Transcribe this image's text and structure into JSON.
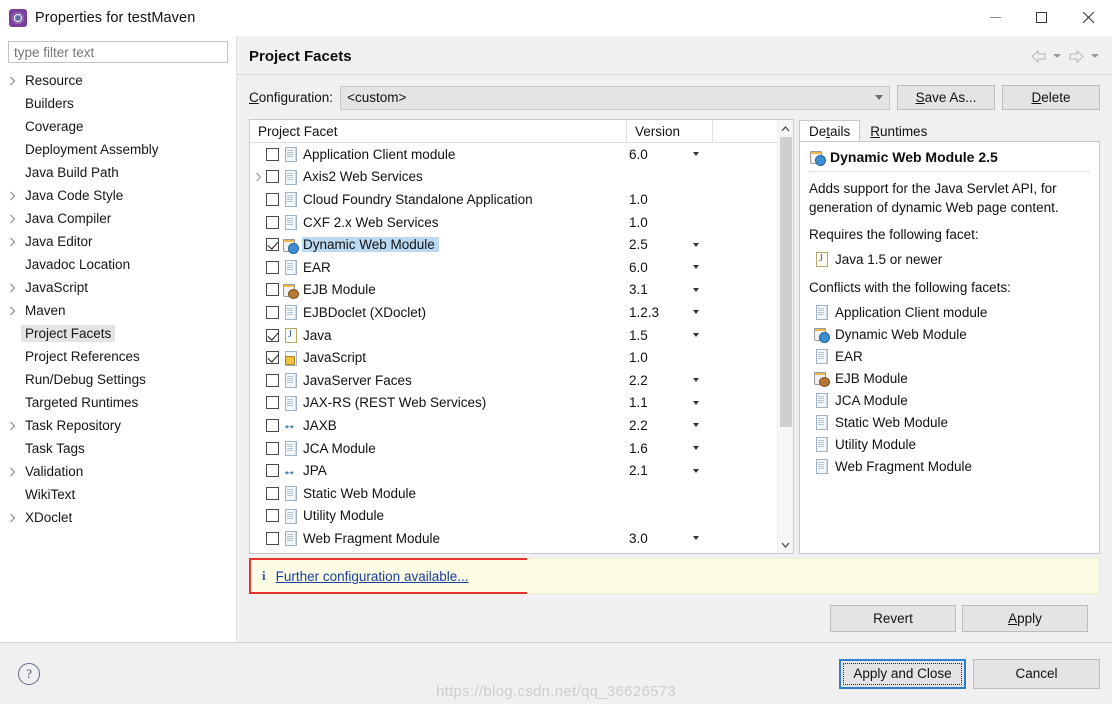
{
  "window": {
    "title": "Properties for testMaven",
    "icon": "eclipse-properties-icon",
    "minimize_label": "—",
    "maximize_label": "□",
    "close_label": "✕"
  },
  "sidebar": {
    "filter_placeholder": "type filter text",
    "filter_value": "",
    "items": [
      {
        "label": "Resource",
        "expandable": true,
        "selected": false
      },
      {
        "label": "Builders",
        "expandable": false,
        "selected": false
      },
      {
        "label": "Coverage",
        "expandable": false,
        "selected": false
      },
      {
        "label": "Deployment Assembly",
        "expandable": false,
        "selected": false
      },
      {
        "label": "Java Build Path",
        "expandable": false,
        "selected": false
      },
      {
        "label": "Java Code Style",
        "expandable": true,
        "selected": false
      },
      {
        "label": "Java Compiler",
        "expandable": true,
        "selected": false
      },
      {
        "label": "Java Editor",
        "expandable": true,
        "selected": false
      },
      {
        "label": "Javadoc Location",
        "expandable": false,
        "selected": false
      },
      {
        "label": "JavaScript",
        "expandable": true,
        "selected": false
      },
      {
        "label": "Maven",
        "expandable": true,
        "selected": false
      },
      {
        "label": "Project Facets",
        "expandable": false,
        "selected": true
      },
      {
        "label": "Project References",
        "expandable": false,
        "selected": false
      },
      {
        "label": "Run/Debug Settings",
        "expandable": false,
        "selected": false
      },
      {
        "label": "Targeted Runtimes",
        "expandable": false,
        "selected": false
      },
      {
        "label": "Task Repository",
        "expandable": true,
        "selected": false
      },
      {
        "label": "Task Tags",
        "expandable": false,
        "selected": false
      },
      {
        "label": "Validation",
        "expandable": true,
        "selected": false
      },
      {
        "label": "WikiText",
        "expandable": false,
        "selected": false
      },
      {
        "label": "XDoclet",
        "expandable": true,
        "selected": false
      }
    ]
  },
  "page": {
    "title": "Project Facets",
    "nav": {
      "back_icon": "back-arrow-icon",
      "back_menu_icon": "chevron-down-icon",
      "forward_icon": "forward-arrow-icon",
      "forward_menu_icon": "chevron-down-icon"
    }
  },
  "configuration": {
    "label": "Configuration:",
    "label_mnemonic": "C",
    "label_rest": "onfiguration:",
    "value": "<custom>",
    "save_as_mnemonic": "S",
    "save_as_rest": "ave As...",
    "delete_mnemonic": "D",
    "delete_rest": "elete"
  },
  "facets_table": {
    "columns": [
      "Project Facet",
      "Version"
    ],
    "rows": [
      {
        "name": "Application Client module",
        "version": "6.0",
        "checked": false,
        "expandable": false,
        "icon": "doc",
        "has_version_menu": true,
        "selected": false
      },
      {
        "name": "Axis2 Web Services",
        "version": "",
        "checked": false,
        "expandable": true,
        "icon": "doc",
        "has_version_menu": false,
        "selected": false
      },
      {
        "name": "Cloud Foundry Standalone Application",
        "version": "1.0",
        "checked": false,
        "expandable": false,
        "icon": "doc",
        "has_version_menu": false,
        "selected": false
      },
      {
        "name": "CXF 2.x Web Services",
        "version": "1.0",
        "checked": false,
        "expandable": false,
        "icon": "doc",
        "has_version_menu": false,
        "selected": false
      },
      {
        "name": "Dynamic Web Module",
        "version": "2.5",
        "checked": true,
        "expandable": false,
        "icon": "web",
        "has_version_menu": true,
        "selected": true
      },
      {
        "name": "EAR",
        "version": "6.0",
        "checked": false,
        "expandable": false,
        "icon": "doc",
        "has_version_menu": true,
        "selected": false
      },
      {
        "name": "EJB Module",
        "version": "3.1",
        "checked": false,
        "expandable": false,
        "icon": "ejb",
        "has_version_menu": true,
        "selected": false
      },
      {
        "name": "EJBDoclet (XDoclet)",
        "version": "1.2.3",
        "checked": false,
        "expandable": false,
        "icon": "doc",
        "has_version_menu": true,
        "selected": false
      },
      {
        "name": "Java",
        "version": "1.5",
        "checked": true,
        "expandable": false,
        "icon": "java",
        "has_version_menu": true,
        "selected": false
      },
      {
        "name": "JavaScript",
        "version": "1.0",
        "checked": true,
        "expandable": false,
        "icon": "js",
        "has_version_menu": false,
        "selected": false
      },
      {
        "name": "JavaServer Faces",
        "version": "2.2",
        "checked": false,
        "expandable": false,
        "icon": "doc",
        "has_version_menu": true,
        "selected": false
      },
      {
        "name": "JAX-RS (REST Web Services)",
        "version": "1.1",
        "checked": false,
        "expandable": false,
        "icon": "doc",
        "has_version_menu": true,
        "selected": false
      },
      {
        "name": "JAXB",
        "version": "2.2",
        "checked": false,
        "expandable": false,
        "icon": "arrows",
        "has_version_menu": true,
        "selected": false
      },
      {
        "name": "JCA Module",
        "version": "1.6",
        "checked": false,
        "expandable": false,
        "icon": "doc",
        "has_version_menu": true,
        "selected": false
      },
      {
        "name": "JPA",
        "version": "2.1",
        "checked": false,
        "expandable": false,
        "icon": "arrows",
        "has_version_menu": true,
        "selected": false
      },
      {
        "name": "Static Web Module",
        "version": "",
        "checked": false,
        "expandable": false,
        "icon": "doc",
        "has_version_menu": false,
        "selected": false
      },
      {
        "name": "Utility Module",
        "version": "",
        "checked": false,
        "expandable": false,
        "icon": "doc",
        "has_version_menu": false,
        "selected": false
      },
      {
        "name": "Web Fragment Module",
        "version": "3.0",
        "checked": false,
        "expandable": false,
        "icon": "doc",
        "has_version_menu": true,
        "selected": false
      }
    ],
    "scrollbar": {
      "up_icon": "scroll-up-icon",
      "down_icon": "scroll-down-icon"
    }
  },
  "details": {
    "tabs": [
      {
        "label": "Details",
        "mnemonic_index": 2,
        "active": true
      },
      {
        "label": "Runtimes",
        "mnemonic_index": 0,
        "active": false
      }
    ],
    "facet_title": "Dynamic Web Module 2.5",
    "facet_icon": "web",
    "description": "Adds support for the Java Servlet API, for generation of dynamic Web page content.",
    "requires_heading": "Requires the following facet:",
    "requires": [
      {
        "label": "Java 1.5 or newer",
        "icon": "java"
      }
    ],
    "conflicts_heading": "Conflicts with the following facets:",
    "conflicts": [
      {
        "label": "Application Client module",
        "icon": "doc"
      },
      {
        "label": "Dynamic Web Module",
        "icon": "web"
      },
      {
        "label": "EAR",
        "icon": "doc"
      },
      {
        "label": "EJB Module",
        "icon": "ejb"
      },
      {
        "label": "JCA Module",
        "icon": "doc"
      },
      {
        "label": "Static Web Module",
        "icon": "doc"
      },
      {
        "label": "Utility Module",
        "icon": "doc"
      },
      {
        "label": "Web Fragment Module",
        "icon": "doc"
      }
    ]
  },
  "info_bar": {
    "icon": "info-icon",
    "icon_glyph": "i",
    "link_text": "Further configuration available...",
    "highlight_color": "#e8312a",
    "background_color": "#fdfce4"
  },
  "apply_bar": {
    "revert_label": "Revert",
    "apply_mnemonic": "A",
    "apply_rest": "pply"
  },
  "footer": {
    "help_icon": "help-icon",
    "help_glyph": "?",
    "apply_and_close_label": "Apply and Close",
    "cancel_label": "Cancel",
    "accent_color": "#2f7fd0"
  },
  "watermark": {
    "text": "https://blog.csdn.net/qq_36626573"
  }
}
